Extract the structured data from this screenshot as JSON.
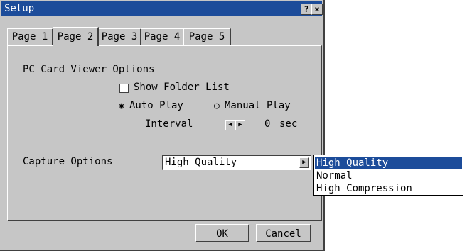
{
  "window": {
    "title": "Setup",
    "help_label": "?",
    "close_label": "×"
  },
  "tabs": [
    {
      "label": "Page 1"
    },
    {
      "label": "Page 2"
    },
    {
      "label": "Page 3"
    },
    {
      "label": "Page 4"
    },
    {
      "label": "Page 5"
    }
  ],
  "active_tab": "Page 2",
  "pc_card": {
    "heading": "PC Card Viewer Options",
    "show_folder_list": {
      "label": "Show Folder List",
      "checked": false
    },
    "auto_play": {
      "label": "Auto Play",
      "selected": true
    },
    "manual_play": {
      "label": "Manual Play",
      "selected": false
    },
    "interval": {
      "label": "Interval",
      "value": "0",
      "unit": "sec"
    }
  },
  "capture": {
    "label": "Capture Options",
    "selected": "High Quality",
    "options": [
      "High Quality",
      "Normal",
      "High Compression"
    ]
  },
  "buttons": {
    "ok": "OK",
    "cancel": "Cancel"
  },
  "colors": {
    "titlebar": "#1c4c9a",
    "selection": "#1c4c9a",
    "face": "#c6c6c6"
  }
}
